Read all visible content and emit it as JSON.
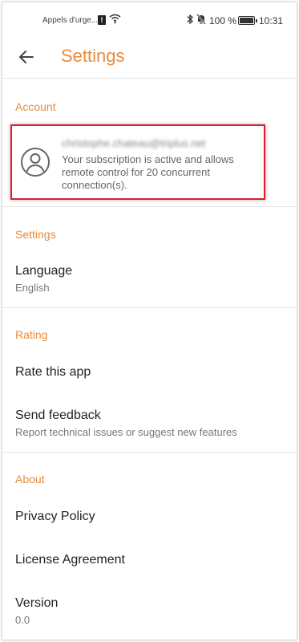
{
  "status_bar": {
    "carrier": "Appels d'urge...",
    "sim_badge": "!",
    "battery_percent": "100 %",
    "battery_level": 1.0,
    "time": "10:31"
  },
  "app_bar": {
    "back_icon": "arrow-left-icon",
    "title": "Settings"
  },
  "account": {
    "header": "Account",
    "email": "christophe.chateau@triplus.net",
    "description": "Your subscription is active and allows remote control for 20 concurrent connection(s).",
    "avatar_icon": "account-circle-icon"
  },
  "settings": {
    "header": "Settings",
    "language": {
      "label": "Language",
      "value": "English"
    }
  },
  "rating": {
    "header": "Rating",
    "rate": {
      "label": "Rate this app"
    },
    "feedback": {
      "label": "Send feedback",
      "sub": "Report technical issues or suggest new features"
    }
  },
  "about": {
    "header": "About",
    "privacy": {
      "label": "Privacy Policy"
    },
    "license": {
      "label": "License Agreement"
    },
    "version": {
      "label": "Version",
      "value": "0.0"
    }
  },
  "colors": {
    "accent": "#e88a3a",
    "highlight_border": "#e11d2b"
  }
}
